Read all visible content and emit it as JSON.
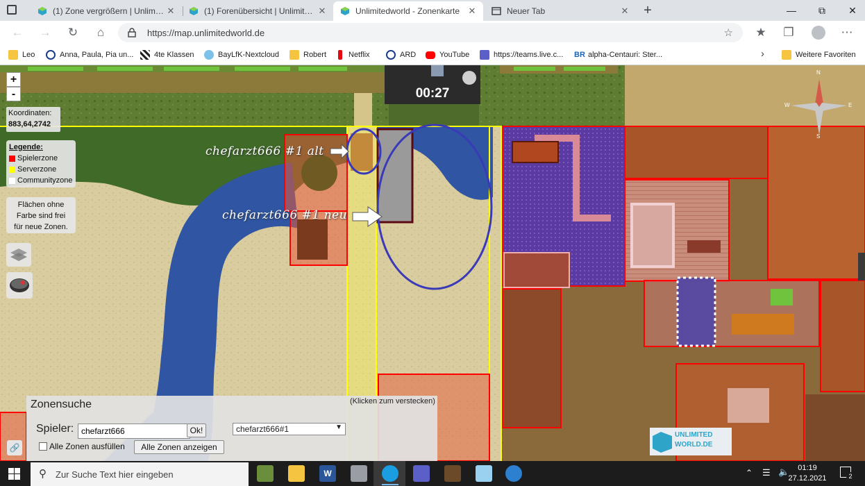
{
  "browser": {
    "tabs": [
      {
        "title": "(1) Zone vergrößern | Unlimitedworld",
        "active": false
      },
      {
        "title": "(1) Forenübersicht | Unlimitedworld",
        "active": false
      },
      {
        "title": "Unlimitedworld - Zonenkarte",
        "active": true
      },
      {
        "title": "Neuer Tab",
        "active": false
      }
    ],
    "url": "https://map.unlimitedworld.de",
    "bookmarks": [
      "Leo",
      "Anna, Paula, Pia un...",
      "4te Klassen",
      "BayLfK-Nextcloud",
      "Robert",
      "Netflix",
      "ARD",
      "YouTube",
      "https://teams.live.c...",
      "alpha-Centauri: Ster..."
    ],
    "other_favorites": "Weitere Favoriten"
  },
  "map": {
    "zoom_in": "+",
    "zoom_out": "-",
    "timer": "00:27",
    "coords_label": "Koordinaten:",
    "coords_value": "883,64,2742",
    "legend": {
      "title": "Legende:",
      "items": [
        {
          "label": "Spielerzone",
          "color": "#ff0000"
        },
        {
          "label": "Serverzone",
          "color": "#ffff00"
        },
        {
          "label": "Communityzone",
          "color": "#ffffff"
        }
      ]
    },
    "free_note": "Flächen ohne Farbe sind frei für neue Zonen.",
    "annotations": {
      "old": "chefarzt666 #1 alt",
      "new": "chefarzt666 #1 neu"
    },
    "compass": {
      "n": "N",
      "e": "E",
      "s": "S",
      "w": "W"
    },
    "logo": "UNLIMITED WORLD.DE"
  },
  "zone_search": {
    "title": "Zonensuche",
    "hide_hint": "(Klicken zum verstecken)",
    "player_label": "Spieler:",
    "player_value": "chefarzt666",
    "ok_label": "Ok!",
    "zone_select": "chefarzt666#1",
    "fill_all_label": "Alle Zonen ausfüllen",
    "show_all_label": "Alle Zonen anzeigen"
  },
  "taskbar": {
    "search_placeholder": "Zur Suche Text hier eingeben",
    "time": "01:19",
    "date": "27.12.2021",
    "notifications": "2"
  }
}
